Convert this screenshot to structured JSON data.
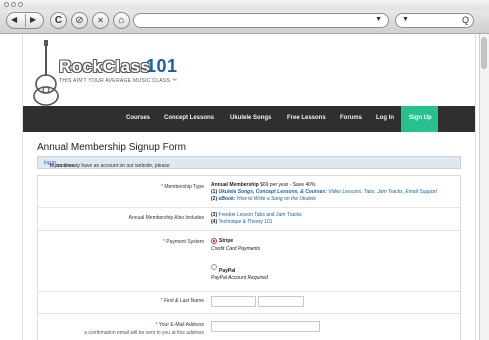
{
  "browser": {
    "nav_back_glyph": "◀",
    "nav_forward_glyph": "▶",
    "reload_glyph": "C",
    "stop_glyph": "⊘",
    "close_glyph": "✕",
    "home_glyph": "⌂",
    "url_dropdown_glyph": "▼",
    "search_dropdown_glyph": "▼",
    "search_glyph": "Q"
  },
  "logo": {
    "wordmark": "RockClass",
    "number": "101",
    "tagline": "THIS AIN'T YOUR AVERAGE MUSIC CLASS ™"
  },
  "nav": {
    "items": [
      "Courses",
      "Concept Lessons",
      "Ukulele Songs",
      "Free Lessons",
      "Forums",
      "Log In"
    ],
    "signup": "Sign Up"
  },
  "page": {
    "title": "Annual Membership Signup Form",
    "notice_prefix": "If you already have an account on our website, please",
    "notice_link": "log in",
    "notice_suffix": "to continue"
  },
  "form": {
    "membership_type": {
      "label": "Membership Type",
      "line1_bold": "Annual Membership",
      "line1_rest": "$69 per year - Save 40%",
      "line2_num": "(1)",
      "line2_bold": "Ukulele Songs, Concept Lessons, & Courses:",
      "line2_rest": "Video Lessons, Tabs, Jam Tracks, Email Support",
      "line3_num": "(2)",
      "line3_bold": "eBook:",
      "line3_rest": "How to Write a Song on the Ukulele"
    },
    "also_includes": {
      "label": "Annual Membership Also Includes",
      "line1_num": "(3)",
      "line1_link": "Freebie Lesson Tabs and Jam Tracks",
      "line2_num": "(4)",
      "line2_link": "Technique & Theory 101"
    },
    "payment": {
      "label": "Payment System",
      "option1": "Stripe",
      "option1_sub": "Credit Card Payments",
      "option2": "PayPal",
      "option2_sub": "PayPal Account Required"
    },
    "name": {
      "label": "First & Last Name"
    },
    "email": {
      "label": "Your E-Mail Address",
      "sub": "a confirmation email will be sent to you at this address"
    }
  },
  "colors": {
    "nav_bg": "#2f2f2f",
    "signup_bg": "#27c08f",
    "link": "#1d5fa6",
    "required": "#c0392b"
  }
}
